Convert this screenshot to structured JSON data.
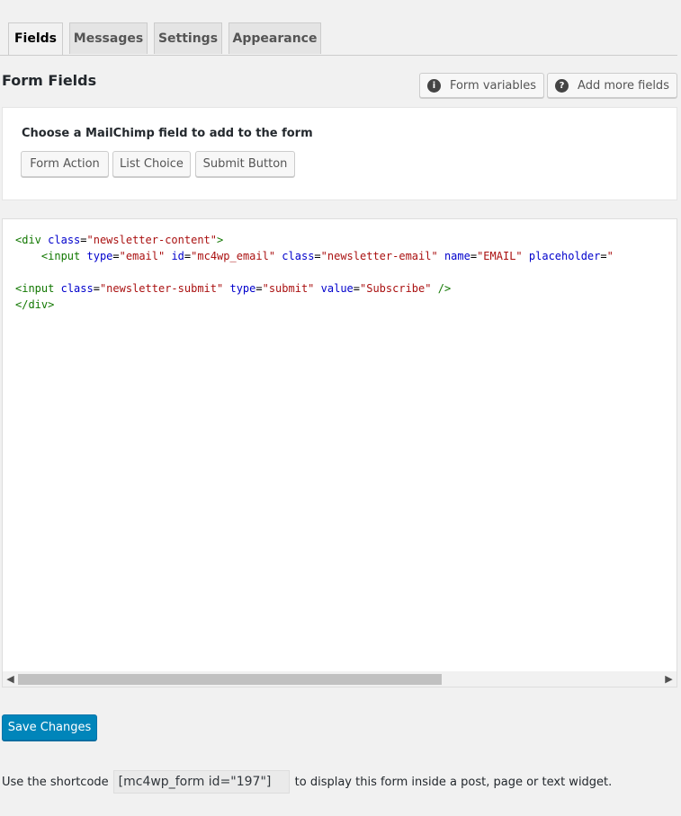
{
  "tabs": [
    {
      "label": "Fields",
      "active": true
    },
    {
      "label": "Messages",
      "active": false
    },
    {
      "label": "Settings",
      "active": false
    },
    {
      "label": "Appearance",
      "active": false
    }
  ],
  "section_title": "Form Fields",
  "actions": {
    "form_variables": "Form variables",
    "add_more_fields": "Add more fields"
  },
  "chooser": {
    "heading": "Choose a MailChimp field to add to the form",
    "buttons": [
      "Form Action",
      "List Choice",
      "Submit Button"
    ]
  },
  "editor": {
    "lines": [
      "<div class=\"newsletter-content\">",
      "    <input type=\"email\" id=\"mc4wp_email\" class=\"newsletter-email\" name=\"EMAIL\" placeholder=\"",
      "",
      "<input class=\"newsletter-submit\" type=\"submit\" value=\"Subscribe\" />",
      "</div>"
    ]
  },
  "save_label": "Save Changes",
  "shortcode": {
    "prefix": "Use the shortcode",
    "value": "[mc4wp_form id=\"197\"]",
    "suffix": "to display this form inside a post, page or text widget."
  },
  "colors": {
    "primary": "#0085ba",
    "tag": "#117700",
    "attribute": "#0000cc",
    "string": "#aa1111"
  }
}
